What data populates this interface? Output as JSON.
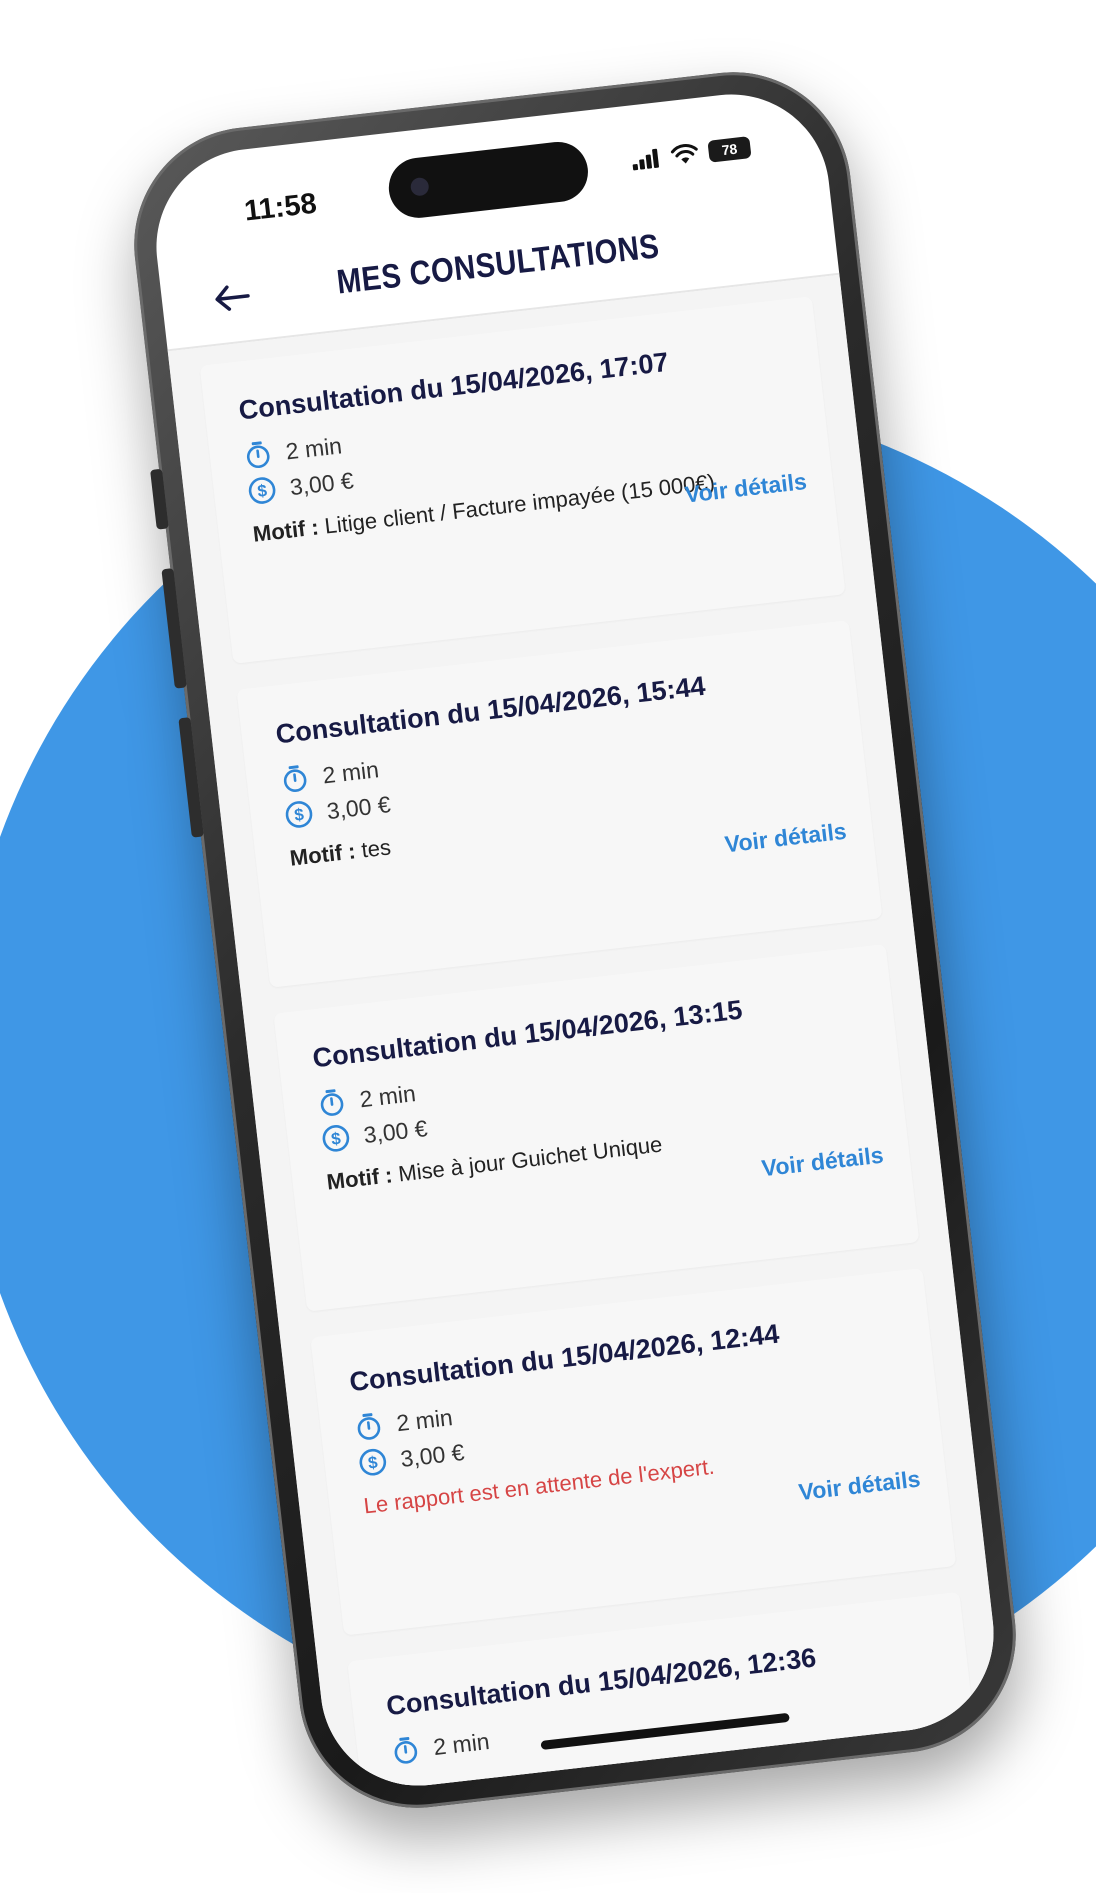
{
  "status_bar": {
    "time": "11:58",
    "battery": "78"
  },
  "header": {
    "title": "MES CONSULTATIONS",
    "back_icon": "arrow-left-icon"
  },
  "consultations": [
    {
      "title": "Consultation du 15/04/2026, 17:07",
      "duration": "2 min",
      "price": "3,00 €",
      "motif_label": "Motif :",
      "motif_value": "Litige client / Facture impayée (15 000€)",
      "details_label": "Voir détails"
    },
    {
      "title": "Consultation du 15/04/2026, 15:44",
      "duration": "2 min",
      "price": "3,00 €",
      "motif_label": "Motif :",
      "motif_value": "tes",
      "details_label": "Voir détails"
    },
    {
      "title": "Consultation du 15/04/2026, 13:15",
      "duration": "2 min",
      "price": "3,00 €",
      "motif_label": "Motif :",
      "motif_value": "Mise à jour Guichet Unique",
      "details_label": "Voir détails"
    },
    {
      "title": "Consultation du 15/04/2026, 12:44",
      "duration": "2 min",
      "price": "3,00 €",
      "pending_message": "Le rapport est en attente de l'expert.",
      "details_label": "Voir détails"
    },
    {
      "title": "Consultation du 15/04/2026, 12:36",
      "duration": "2 min"
    }
  ],
  "colors": {
    "background_circle": "#3f97e6",
    "title_navy": "#171a44",
    "link_blue": "#2f86d6",
    "pending_red": "#d64545",
    "icon_blue": "#2f86d6"
  },
  "icons": {
    "duration": "stopwatch-icon",
    "price": "dollar-coin-icon",
    "signal": "signal-icon",
    "wifi": "wifi-icon"
  }
}
